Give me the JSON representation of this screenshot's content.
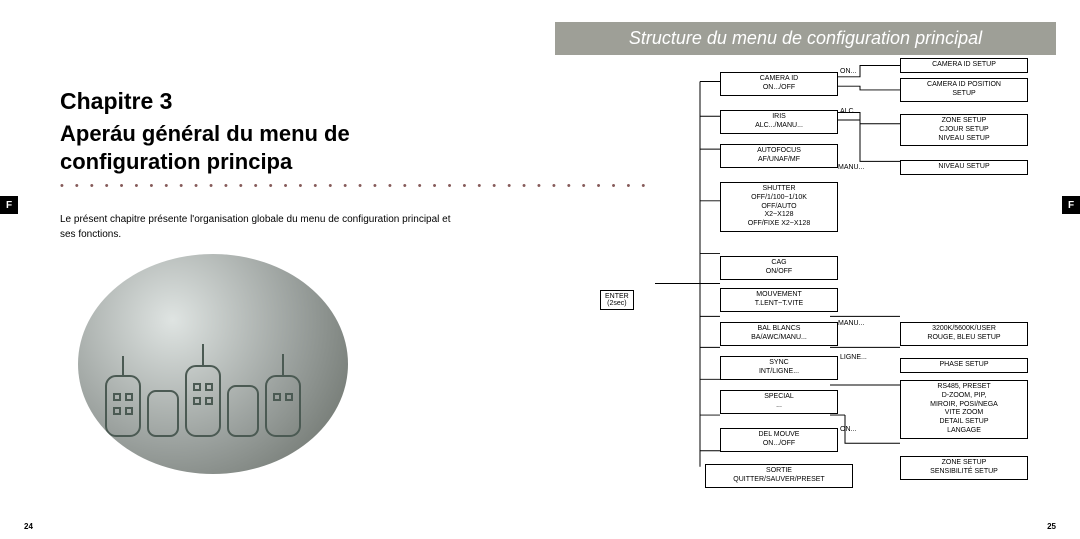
{
  "header_title": "Structure du menu de configuration principal",
  "chapter": "Chapitre 3",
  "section_title_l1": "Aperáu général du menu de",
  "section_title_l2": "configuration principa",
  "dots": "• • • • • • • • • • • • • • • • • • • • • • • • • • • • • • • • • • • • • • • •",
  "intro": "Le présent chapitre présente l'organisation globale du menu de configuration principal et ses fonctions.",
  "ftab": "F",
  "page_left": "24",
  "page_right": "25",
  "enter_l1": "ENTER",
  "enter_l2": "(2sec)",
  "col1": {
    "camera_id": "CAMERA ID\nON.../OFF",
    "iris": "IRIS\nALC.../MANU...",
    "autofocus": "AUTOFOCUS\nAF/UNAF/MF",
    "shutter": "SHUTTER\nOFF/1/100~1/10K\nOFF/AUTO\nX2~X128\nOFF/FIXE X2~X128",
    "cag": "CAG\nON/OFF",
    "mouvement": "MOUVEMENT\nT.LENT~T.VITE",
    "balblancs": "BAL BLANCS\nBA/AWC/MANU...",
    "sync": "SYNC\nINT/LIGNE...",
    "special": "SPECIAL\n...",
    "delmouve": "DEL MOUVE\nON.../OFF",
    "sortie": "SORTIE\nQUITTER/SAUVER/PRESET"
  },
  "conn": {
    "on1": "ON...",
    "alc": "ALC...",
    "manu_iris": "MANU...",
    "manu_bal": "MANU...",
    "ligne": "LIGNE...",
    "on2": "ON..."
  },
  "col3": {
    "camera_id_setup": "CAMERA ID SETUP",
    "camera_id_pos": "CAMERA ID POSITION\nSETUP",
    "zone": "ZONE SETUP\nCJOUR SETUP\nNIVEAU SETUP",
    "niveau": "NIVEAU SETUP",
    "wb": "3200K/5600K/USER\nROUGE, BLEU SETUP",
    "phase": "PHASE SETUP",
    "special": "RS485, PRESET\nD-ZOOM, PIP,\nMIROIR, POSI/NEGA\nVITE ZOOM\nDETAIL SETUP\nLANGAGE",
    "delmouve": "ZONE SETUP\nSENSIBILITÉ SETUP"
  }
}
